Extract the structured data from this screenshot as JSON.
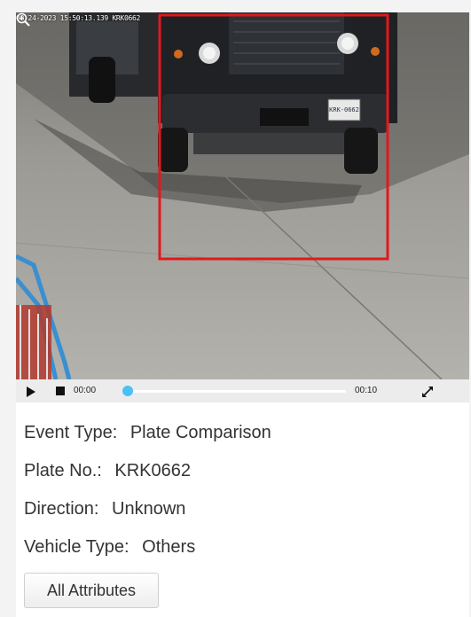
{
  "video": {
    "timestamp_overlay": "08-24-2023 15:50:13.139 KRK0662",
    "plate_text": "KRK-0662",
    "detection_box_color": "#e0191e",
    "zoom_icon": "zoom-in-icon"
  },
  "player": {
    "current_time": "00:00",
    "total_time": "00:10",
    "progress_fraction": 0.0,
    "play_icon": "play-icon",
    "stop_icon": "stop-icon",
    "fullscreen_icon": "fullscreen-icon",
    "accent": "#4cc1f5"
  },
  "details": {
    "event_type": {
      "label": "Event Type:",
      "value": "Plate Comparison"
    },
    "plate_no": {
      "label": "Plate No.:",
      "value": "KRK0662"
    },
    "direction": {
      "label": "Direction:",
      "value": "Unknown"
    },
    "vehicle_type": {
      "label": "Vehicle Type:",
      "value": "Others"
    }
  },
  "buttons": {
    "all_attributes": "All Attributes"
  }
}
